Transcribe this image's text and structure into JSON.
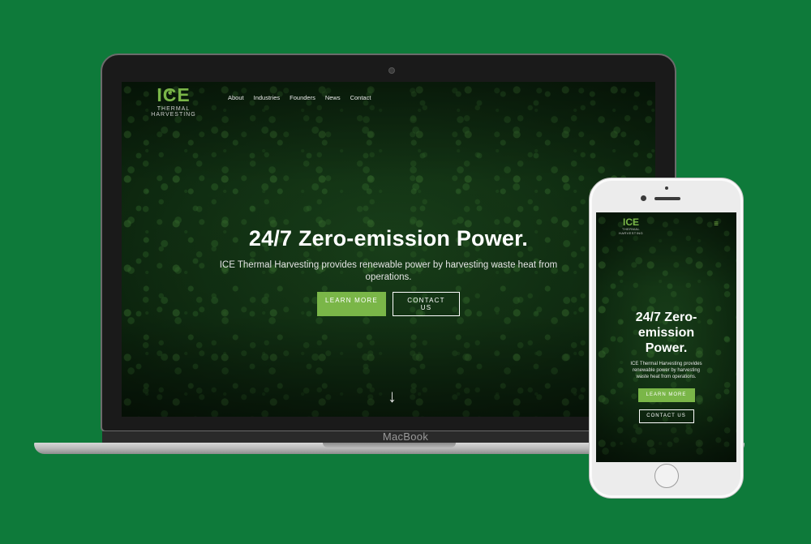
{
  "laptop": {
    "brand": "MacBook"
  },
  "site": {
    "logo": {
      "mark": "ICE",
      "subtitle": "THERMAL HARVESTING",
      "sprout_icon": "sprout-icon"
    },
    "nav": [
      "About",
      "Industries",
      "Founders",
      "News",
      "Contact"
    ],
    "hero": {
      "title": "24/7 Zero-emission Power.",
      "subtitle": "ICE Thermal Harvesting provides renewable power by harvesting waste heat from operations.",
      "primary_button": "LEARN MORE",
      "secondary_button": "CONTACT US",
      "scroll_icon": "↓"
    }
  },
  "mobile": {
    "menu_icon": "≡",
    "title": "24/7 Zero-emission Power.",
    "subtitle": "ICE Thermal Harvesting provides renewable power by harvesting waste heat from operations."
  },
  "colors": {
    "background": "#0e7a3a",
    "accent": "#7ab648"
  }
}
